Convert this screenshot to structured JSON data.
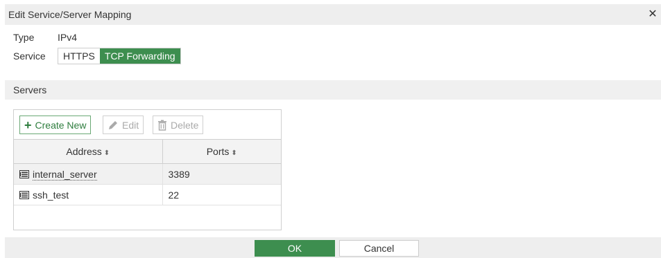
{
  "dialog": {
    "title": "Edit Service/Server Mapping",
    "close_icon": "close-icon"
  },
  "fields": {
    "type_label": "Type",
    "type_value": "IPv4",
    "service_label": "Service",
    "service_options": [
      "HTTPS",
      "TCP Forwarding"
    ],
    "service_selected": "TCP Forwarding"
  },
  "servers": {
    "section_title": "Servers",
    "toolbar": {
      "create_label": "Create New",
      "edit_label": "Edit",
      "delete_label": "Delete"
    },
    "columns": [
      "Address",
      "Ports"
    ],
    "rows": [
      {
        "address": "internal_server",
        "ports": "3389"
      },
      {
        "address": "ssh_test",
        "ports": "22"
      }
    ]
  },
  "footer": {
    "ok_label": "OK",
    "cancel_label": "Cancel"
  },
  "colors": {
    "accent_green": "#3d8e4f",
    "header_gray": "#eeeeee"
  }
}
